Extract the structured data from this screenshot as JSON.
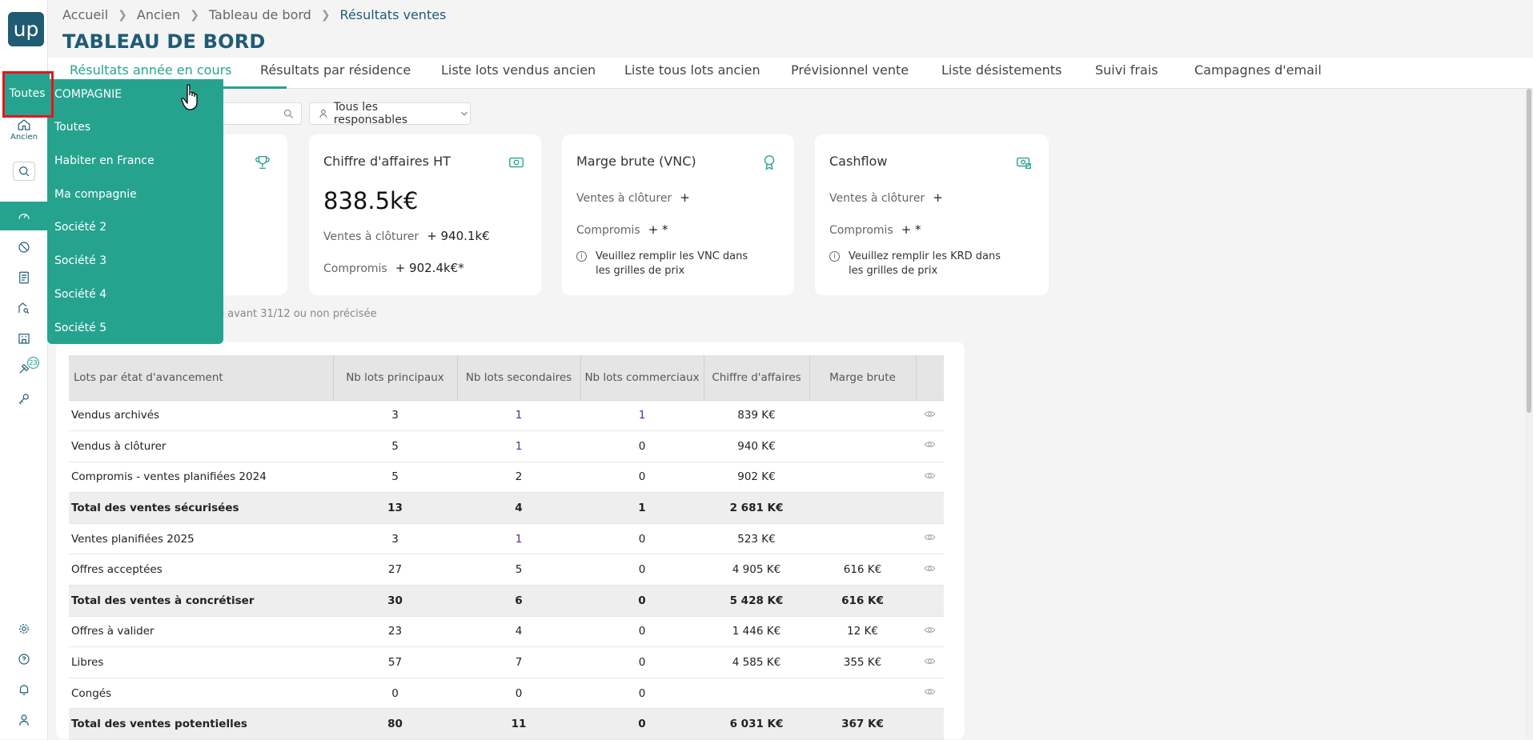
{
  "sidebar": {
    "logo_text": "up",
    "selected_filter": "Toutes",
    "ancien_label": "Ancien",
    "notification_badge": "23",
    "accent_color": "#26a38f"
  },
  "header": {
    "breadcrumb": [
      "Accueil",
      "Ancien",
      "Tableau de bord",
      "Résultats ventes"
    ],
    "title": "TABLEAU DE BORD"
  },
  "tabs": [
    {
      "label": "Résultats année en cours",
      "active": true
    },
    {
      "label": "Résultats par résidence",
      "active": false
    },
    {
      "label": "Liste lots vendus ancien",
      "active": false
    },
    {
      "label": "Liste tous lots ancien",
      "active": false
    },
    {
      "label": "Prévisionnel vente",
      "active": false
    },
    {
      "label": "Liste désistements",
      "active": false
    },
    {
      "label": "Suivi frais",
      "active": false
    },
    {
      "label": "Campagnes d'email",
      "active": false
    }
  ],
  "filters": {
    "responsable": "Tous les responsables"
  },
  "company_menu": {
    "header": "Compagnie",
    "options": [
      "Toutes",
      "Habiter en France",
      "Ma compagnie",
      "Société 2",
      "Société 3",
      "Société 4",
      "Société 5"
    ]
  },
  "cards": {
    "ca": {
      "title": "Chiffre d'affaires HT",
      "value": "838.5k€",
      "row1_label": "Ventes à clôturer",
      "row1_value": "+ 940.1k€",
      "row2_label": "Compromis",
      "row2_value": "+ 902.4k€*"
    },
    "marge": {
      "title": "Marge brute (VNC)",
      "row1_label": "Ventes à clôturer",
      "row1_value": "+",
      "row2_label": "Compromis",
      "row2_value": "+ *",
      "note": "Veuillez remplir les VNC dans les grilles de prix"
    },
    "cashflow": {
      "title": "Cashflow",
      "row1_label": "Ventes à clôturer",
      "row1_value": "+",
      "row2_label": "Compromis",
      "row2_value": "+ *",
      "note": "Veuillez remplir les KRD dans les grilles de prix"
    }
  },
  "footnote": "e avant 31/12 ou non précisée",
  "table": {
    "headers": [
      "Lots par état d'avancement",
      "Nb lots principaux",
      "Nb lots secondaires",
      "Nb lots commerciaux",
      "Chiffre d'affaires",
      "Marge brute",
      ""
    ],
    "rows": [
      {
        "label": "Vendus archivés",
        "principaux": "3",
        "secondaires": "1",
        "commerciaux": "1",
        "ca": "839 K€",
        "marge": "",
        "total": false,
        "eye": true
      },
      {
        "label": "Vendus à clôturer",
        "principaux": "5",
        "secondaires": "1",
        "commerciaux": "0",
        "ca": "940 K€",
        "marge": "",
        "total": false,
        "eye": true
      },
      {
        "label": "Compromis - ventes planifiées 2024",
        "principaux": "5",
        "secondaires": "2",
        "commerciaux": "0",
        "ca": "902 K€",
        "marge": "",
        "total": false,
        "eye": true
      },
      {
        "label": "Total des ventes sécurisées",
        "principaux": "13",
        "secondaires": "4",
        "commerciaux": "1",
        "ca": "2 681 K€",
        "marge": "",
        "total": true,
        "eye": false
      },
      {
        "label": "Ventes planifiées 2025",
        "principaux": "3",
        "secondaires": "1",
        "commerciaux": "0",
        "ca": "523 K€",
        "marge": "",
        "total": false,
        "eye": true
      },
      {
        "label": "Offres acceptées",
        "principaux": "27",
        "secondaires": "5",
        "commerciaux": "0",
        "ca": "4 905 K€",
        "marge": "616 K€",
        "total": false,
        "eye": true
      },
      {
        "label": "Total des ventes à concrétiser",
        "principaux": "30",
        "secondaires": "6",
        "commerciaux": "0",
        "ca": "5 428 K€",
        "marge": "616 K€",
        "total": true,
        "eye": false
      },
      {
        "label": "Offres à valider",
        "principaux": "23",
        "secondaires": "4",
        "commerciaux": "0",
        "ca": "1 446 K€",
        "marge": "12 K€",
        "total": false,
        "eye": true
      },
      {
        "label": "Libres",
        "principaux": "57",
        "secondaires": "7",
        "commerciaux": "0",
        "ca": "4 585 K€",
        "marge": "355 K€",
        "total": false,
        "eye": true
      },
      {
        "label": "Congés",
        "principaux": "0",
        "secondaires": "0",
        "commerciaux": "0",
        "ca": "",
        "marge": "",
        "total": false,
        "eye": true
      },
      {
        "label": "Total des ventes potentielles",
        "principaux": "80",
        "secondaires": "11",
        "commerciaux": "0",
        "ca": "6 031 K€",
        "marge": "367 K€",
        "total": true,
        "eye": false
      }
    ]
  }
}
